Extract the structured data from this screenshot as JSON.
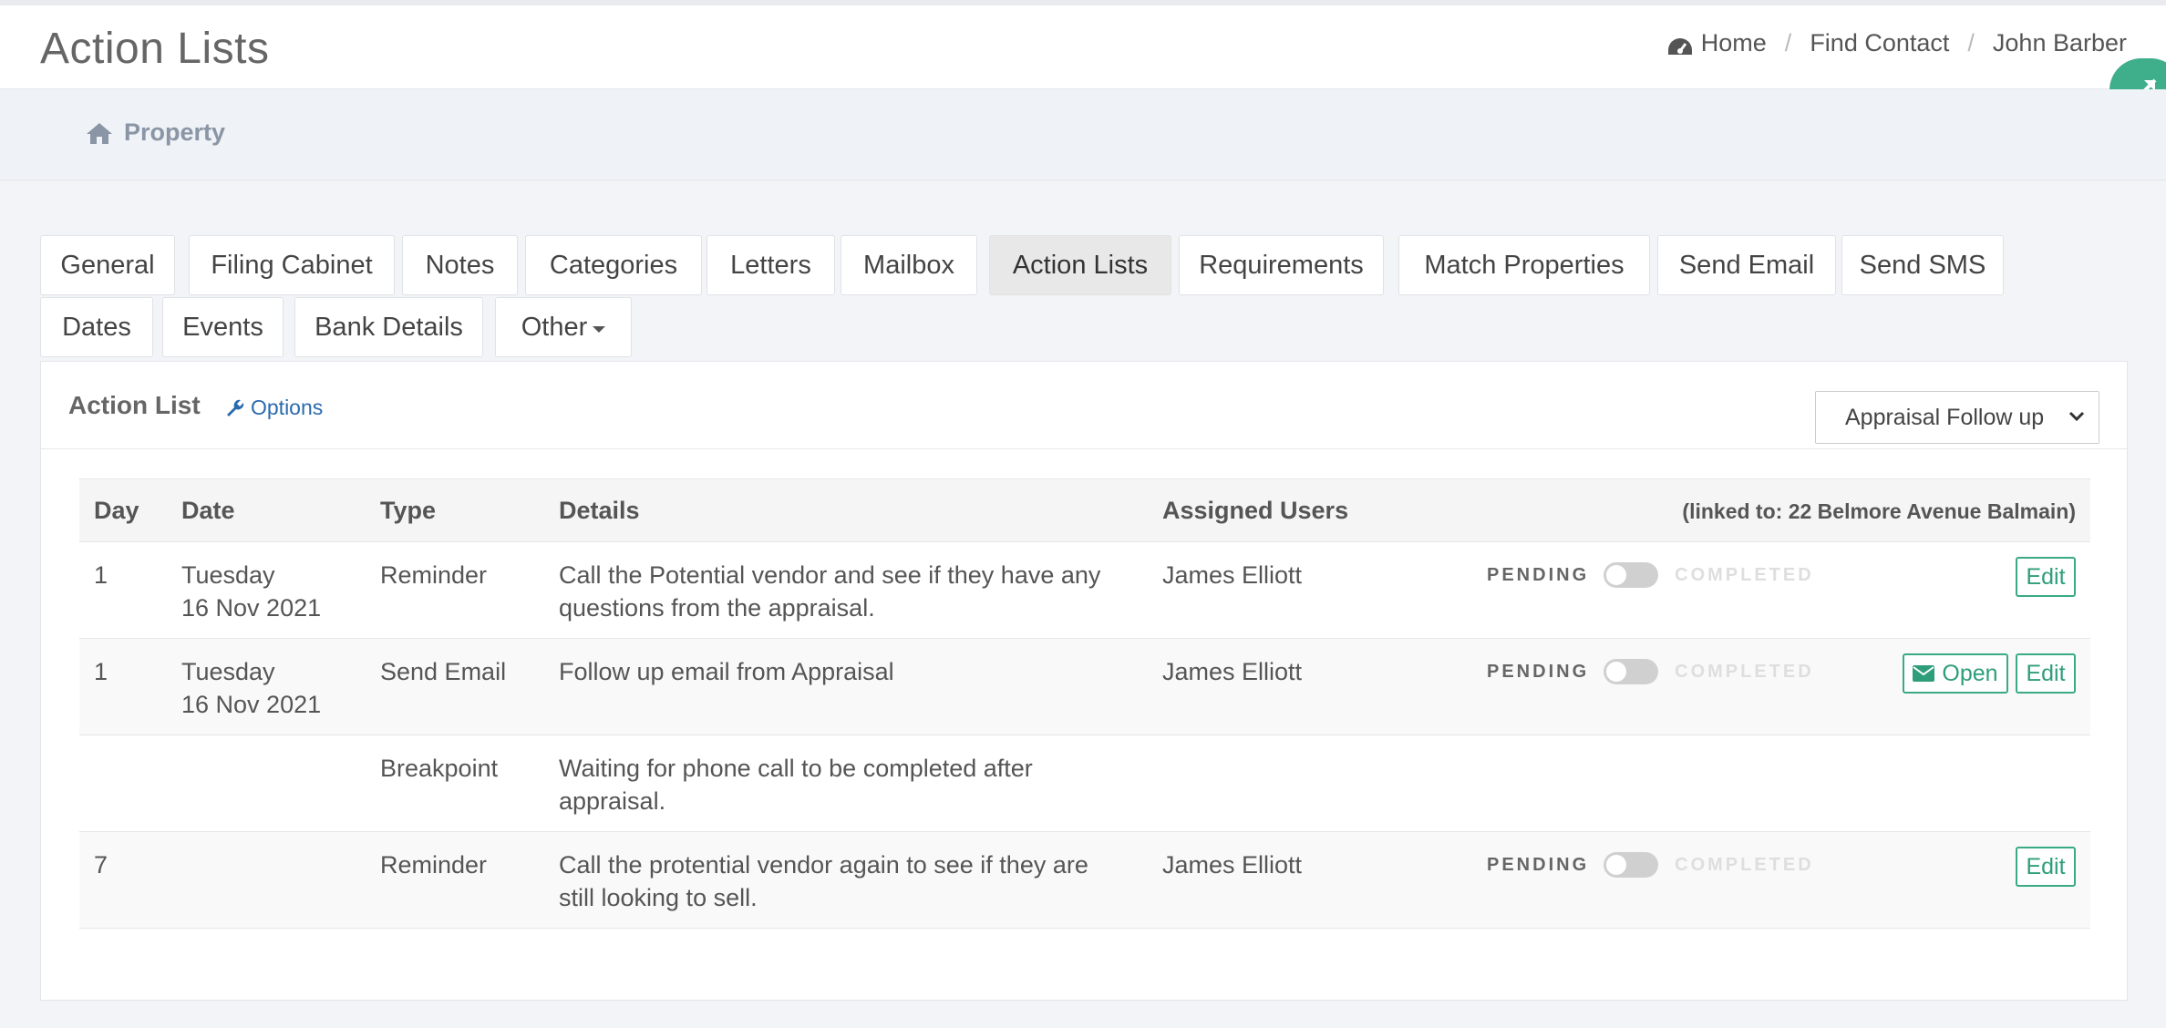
{
  "header": {
    "title": "Action Lists",
    "breadcrumb": [
      "Home",
      "Find Contact",
      "John Barber"
    ]
  },
  "subnav": {
    "item": "Property"
  },
  "tabs": [
    "General",
    "Filing Cabinet",
    "Notes",
    "Categories",
    "Letters",
    "Mailbox",
    "Action Lists",
    "Requirements",
    "Match Properties",
    "Send Email",
    "Send SMS",
    "Dates",
    "Events",
    "Bank Details",
    "Other"
  ],
  "active_tab": "Action Lists",
  "panel": {
    "title": "Action List",
    "options_label": "Options",
    "select_value": "Appraisal Follow up"
  },
  "table": {
    "headers": [
      "Day",
      "Date",
      "Type",
      "Details",
      "Assigned Users"
    ],
    "linked_to": "(linked to: 22 Belmore Avenue Balmain)",
    "status_pending": "PENDING",
    "status_completed": "COMPLETED",
    "edit_label": "Edit",
    "open_label": "Open",
    "rows": [
      {
        "day": "1",
        "date_line1": "Tuesday",
        "date_line2": "16 Nov 2021",
        "type": "Reminder",
        "details": "Call the Potential vendor and see if they have any questions from the appraisal.",
        "user": "James Elliott"
      },
      {
        "day": "1",
        "date_line1": "Tuesday",
        "date_line2": "16 Nov 2021",
        "type": "Send Email",
        "details": "Follow up email from Appraisal",
        "user": "James Elliott"
      },
      {
        "day": "",
        "date_line1": "",
        "date_line2": "",
        "type": "Breakpoint",
        "details": "Waiting for phone call to be completed after appraisal.",
        "user": ""
      },
      {
        "day": "7",
        "date_line1": "",
        "date_line2": "",
        "type": "Reminder",
        "details": "Call the protential vendor again to see if they are still looking to sell.",
        "user": "James Elliott"
      }
    ]
  },
  "colors": {
    "accent_green": "#3aaa85",
    "link_blue": "#2a6aad"
  }
}
